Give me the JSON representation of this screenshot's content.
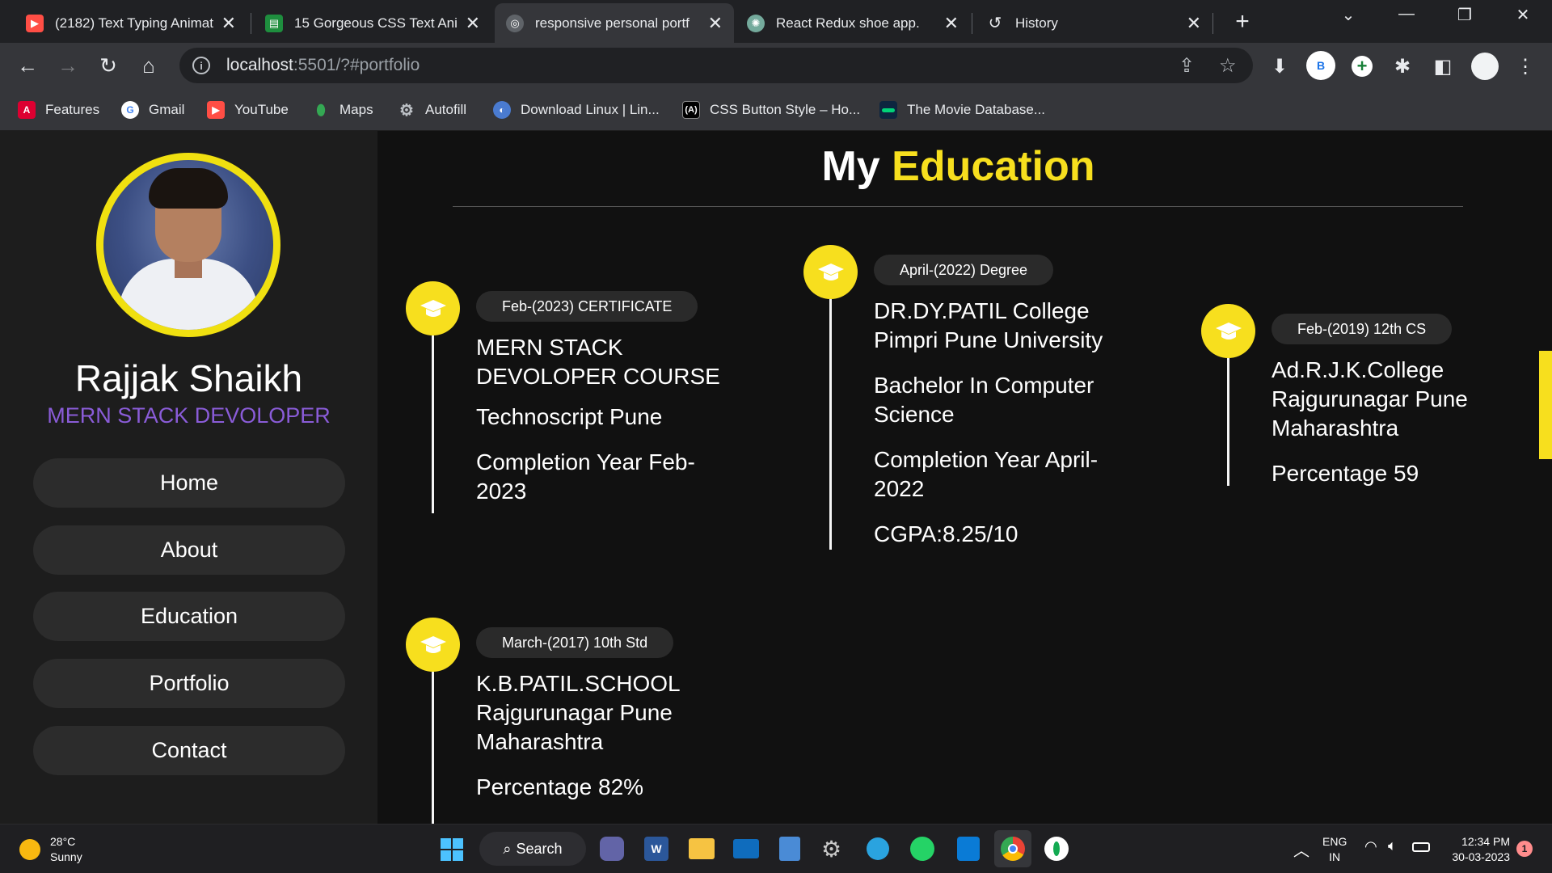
{
  "browser": {
    "tabs": [
      {
        "title": "(2182) Text Typing Animat",
        "icon": "youtube-icon",
        "color": "#ff4e45"
      },
      {
        "title": "15 Gorgeous CSS Text Ani",
        "icon": "sheet-icon",
        "color": "#1e8e3e"
      },
      {
        "title": "responsive personal portf",
        "icon": "globe-icon",
        "color": "#9aa0a6"
      },
      {
        "title": "React Redux shoe app.",
        "icon": "chatgpt-icon",
        "color": "#74aa9c"
      },
      {
        "title": "History",
        "icon": "history-icon",
        "color": "#e8eaed"
      }
    ],
    "url_host": "localhost",
    "url_rest": ":5501/?#portfolio",
    "profile_letter": "B",
    "bookmarks": [
      {
        "label": "Features",
        "icon": "angular-icon",
        "color": "#dd0031"
      },
      {
        "label": "Gmail",
        "icon": "google-icon",
        "color": "#ffffff"
      },
      {
        "label": "YouTube",
        "icon": "youtube-icon",
        "color": "#ff4e45"
      },
      {
        "label": "Maps",
        "icon": "maps-icon",
        "color": "#34a853"
      },
      {
        "label": "Autofill",
        "icon": "gear-icon",
        "color": "#9aa0a6"
      },
      {
        "label": "Download Linux | Lin...",
        "icon": "linux-globe-icon",
        "color": "#4a7bd0"
      },
      {
        "label": "CSS Button Style – Ho...",
        "icon": "css-a-icon",
        "color": "#000000"
      },
      {
        "label": "The Movie Database...",
        "icon": "tmdb-icon",
        "color": "#0d253f"
      }
    ]
  },
  "sidebar": {
    "name": "Rajjak Shaikh",
    "role": "MERN STACK DEVOLOPER",
    "nav": [
      "Home",
      "About",
      "Education",
      "Portfolio",
      "Contact"
    ]
  },
  "main": {
    "title_plain": "My",
    "title_highlight": "Education",
    "items": [
      {
        "badge": "Feb-(2023) CERTIFICATE",
        "lines": [
          "MERN STACK DEVOLOPER COURSE",
          "Technoscript Pune",
          "Completion Year Feb-2023"
        ]
      },
      {
        "badge": "April-(2022) Degree",
        "lines": [
          "DR.DY.PATIL College Pimpri Pune University",
          "Bachelor In Computer Science",
          "Completion Year April-2022",
          "CGPA:8.25/10"
        ]
      },
      {
        "badge": "Feb-(2019) 12th CS",
        "lines": [
          "Ad.R.J.K.College Rajgurunagar Pune Maharashtra",
          "Percentage 59"
        ]
      },
      {
        "badge": "March-(2017) 10th Std",
        "lines": [
          "K.B.PATIL.SCHOOL Rajgurunagar Pune Maharashtra",
          "Percentage 82%"
        ]
      }
    ]
  },
  "taskbar": {
    "weather_temp": "28°C",
    "weather_desc": "Sunny",
    "search_label": "Search",
    "lang_top": "ENG",
    "lang_bottom": "IN",
    "time": "12:34 PM",
    "date": "30-03-2023",
    "notif_count": "1"
  },
  "colors": {
    "accent": "#f7df1e",
    "role": "#8a5cd8",
    "sidebar": "#1d1d1d",
    "page": "#111111"
  }
}
